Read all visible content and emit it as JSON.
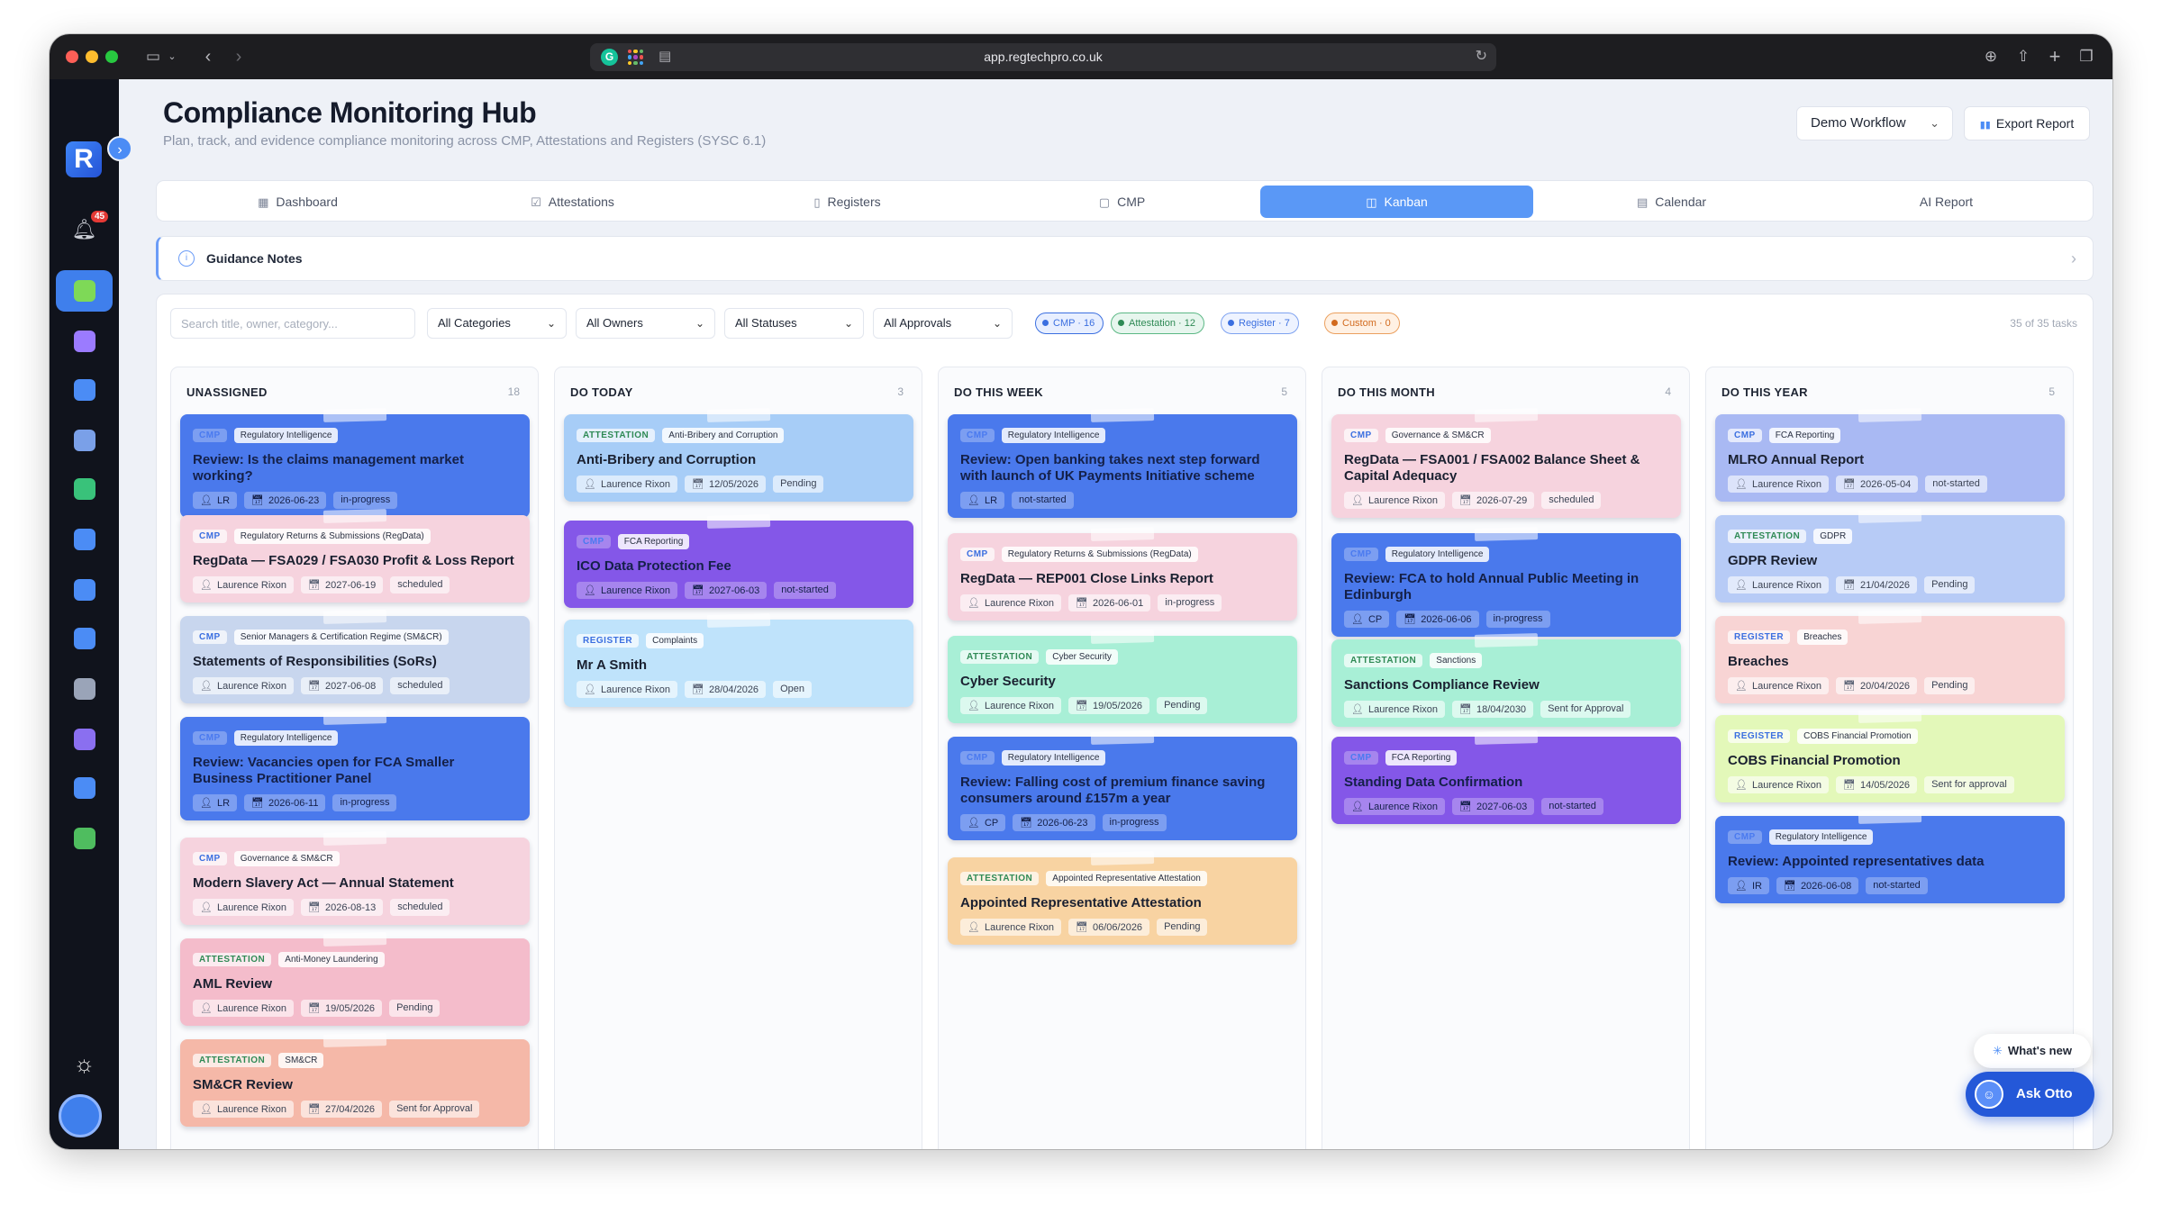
{
  "browser": {
    "url": "app.regtechpro.co.uk"
  },
  "sidebar": {
    "logo": "R",
    "notification_count": "45",
    "items": [
      {
        "name": "sidebar-item-compliance",
        "icon": "document-check-icon",
        "color": "#6bc04b",
        "active": true
      },
      {
        "name": "sidebar-item-people",
        "icon": "people-icon",
        "color": "#9b7bff"
      },
      {
        "name": "sidebar-item-security",
        "icon": "shield-icon",
        "color": "#4b8cf5"
      },
      {
        "name": "sidebar-item-news",
        "icon": "newspaper-icon",
        "color": "#7aa0e8"
      },
      {
        "name": "sidebar-item-protection",
        "icon": "shield-check-icon",
        "color": "#39c27a"
      },
      {
        "name": "sidebar-item-monitor",
        "icon": "target-icon",
        "color": "#4b8cf5"
      },
      {
        "name": "sidebar-item-lock",
        "icon": "lock-shield-icon",
        "color": "#4b8cf5"
      },
      {
        "name": "sidebar-item-network",
        "icon": "network-icon",
        "color": "#4b8cf5"
      },
      {
        "name": "sidebar-item-bank",
        "icon": "bank-icon",
        "color": "#9aa4b8"
      },
      {
        "name": "sidebar-item-list",
        "icon": "list-icon",
        "color": "#8a6ff0"
      },
      {
        "name": "sidebar-item-edit",
        "icon": "edit-doc-icon",
        "color": "#4b8cf5"
      },
      {
        "name": "sidebar-item-card",
        "icon": "card-icon",
        "color": "#4fbd5f"
      }
    ]
  },
  "header": {
    "title": "Compliance Monitoring Hub",
    "subtitle": "Plan, track, and evidence compliance monitoring across CMP, Attestations and Registers (SYSC 6.1)",
    "workflow_select": "Demo Workflow",
    "export_label": "Export Report"
  },
  "tabs": [
    {
      "label": "Dashboard",
      "icon": "dashboard-icon",
      "glyph": "▦"
    },
    {
      "label": "Attestations",
      "icon": "checkbox-icon",
      "glyph": "☑"
    },
    {
      "label": "Registers",
      "icon": "book-icon",
      "glyph": "▯"
    },
    {
      "label": "CMP",
      "icon": "file-icon",
      "glyph": "▢"
    },
    {
      "label": "Kanban",
      "icon": "kanban-icon",
      "glyph": "◫",
      "active": true
    },
    {
      "label": "Calendar",
      "icon": "calendar-icon",
      "glyph": "▤"
    },
    {
      "label": "AI Report",
      "icon": "",
      "glyph": ""
    }
  ],
  "guidance": {
    "label": "Guidance Notes"
  },
  "filters": {
    "search_placeholder": "Search title, owner, category...",
    "categories": "All Categories",
    "owners": "All Owners",
    "statuses": "All Statuses",
    "approvals": "All Approvals",
    "chips": [
      {
        "label": "CMP · 16",
        "color": "#3b6fe0",
        "bg": "#e8efff",
        "border": "#3b6fe0"
      },
      {
        "label": "Attestation · 12",
        "color": "#2f8a55",
        "bg": "#e7f6ee",
        "border": "#5cb885"
      },
      {
        "label": "Register · 7",
        "color": "#3b6fe0",
        "bg": "#eef3ff",
        "border": "#7ea2f0"
      },
      {
        "label": "Custom · 0",
        "color": "#d26a1e",
        "bg": "#fff1e4",
        "border": "#eba05e"
      }
    ],
    "task_count": "35 of 35 tasks"
  },
  "columns": [
    {
      "title": "UNASSIGNED",
      "count": "18",
      "cards": [
        {
          "type": "CMP",
          "category": "Regulatory Intelligence",
          "title": "Review: Is the claims management market working?",
          "owner": "LR",
          "date": "2026-06-23",
          "status": "in-progress",
          "bg": "#4a79ec",
          "dark": true
        },
        {
          "type": "CMP",
          "category": "Regulatory Returns & Submissions (RegData)",
          "title": "RegData — FSA029 / FSA030 Profit & Loss Report",
          "owner": "Laurence Rixon",
          "date": "2027-06-19",
          "status": "scheduled",
          "bg": "#f6d3de",
          "typeColor": "#3b6fe0"
        },
        {
          "type": "CMP",
          "category": "Senior Managers & Certification Regime (SM&CR)",
          "title": "Statements of Responsibilities (SoRs)",
          "owner": "Laurence Rixon",
          "date": "2027-06-08",
          "status": "scheduled",
          "bg": "#c8d6ee",
          "typeColor": "#3b6fe0"
        },
        {
          "type": "CMP",
          "category": "Regulatory Intelligence",
          "title": "Review: Vacancies open for FCA Smaller Business Practitioner Panel",
          "owner": "LR",
          "date": "2026-06-11",
          "status": "in-progress",
          "bg": "#4a79ec",
          "dark": true
        },
        {
          "type": "CMP",
          "category": "Governance & SM&CR",
          "title": "Modern Slavery Act — Annual Statement",
          "owner": "Laurence Rixon",
          "date": "2026-08-13",
          "status": "scheduled",
          "bg": "#f6d3de",
          "typeColor": "#3b6fe0"
        },
        {
          "type": "ATTESTATION",
          "category": "Anti-Money Laundering",
          "title": "AML Review",
          "owner": "Laurence Rixon",
          "date": "19/05/2026",
          "status": "Pending",
          "bg": "#f4bccb",
          "typeColor": "#2f8a55"
        },
        {
          "type": "ATTESTATION",
          "category": "SM&CR",
          "title": "SM&CR Review",
          "owner": "Laurence Rixon",
          "date": "27/04/2026",
          "status": "Sent for Approval",
          "bg": "#f5b8a8",
          "typeColor": "#2f8a55"
        }
      ]
    },
    {
      "title": "DO TODAY",
      "count": "3",
      "cards": [
        {
          "type": "ATTESTATION",
          "category": "Anti-Bribery and Corruption",
          "title": "Anti-Bribery and Corruption",
          "owner": "Laurence Rixon",
          "date": "12/05/2026",
          "status": "Pending",
          "bg": "#a7cdf7",
          "typeColor": "#2f8a55"
        },
        {
          "type": "CMP",
          "category": "FCA Reporting",
          "title": "ICO Data Protection Fee",
          "owner": "Laurence Rixon",
          "date": "2027-06-03",
          "status": "not-started",
          "bg": "#8457e8",
          "dark": true
        },
        {
          "type": "REGISTER",
          "category": "Complaints",
          "title": "Mr A Smith",
          "owner": "Laurence Rixon",
          "date": "28/04/2026",
          "status": "Open",
          "bg": "#bfe3fb",
          "typeColor": "#3b6fe0"
        }
      ]
    },
    {
      "title": "DO THIS WEEK",
      "count": "5",
      "cards": [
        {
          "type": "CMP",
          "category": "Regulatory Intelligence",
          "title": "Review: Open banking takes next step forward with launch of UK Payments Initiative scheme",
          "owner": "LR",
          "date": "",
          "status": "not-started",
          "bg": "#4a79ec",
          "dark": true
        },
        {
          "type": "CMP",
          "category": "Regulatory Returns & Submissions (RegData)",
          "title": "RegData — REP001 Close Links Report",
          "owner": "Laurence Rixon",
          "date": "2026-06-01",
          "status": "in-progress",
          "bg": "#f6d3de",
          "typeColor": "#3b6fe0"
        },
        {
          "type": "ATTESTATION",
          "category": "Cyber Security",
          "title": "Cyber Security",
          "owner": "Laurence Rixon",
          "date": "19/05/2026",
          "status": "Pending",
          "bg": "#a8efd6",
          "typeColor": "#2f8a55"
        },
        {
          "type": "CMP",
          "category": "Regulatory Intelligence",
          "title": "Review: Falling cost of premium finance saving consumers around £157m a year",
          "owner": "CP",
          "date": "2026-06-23",
          "status": "in-progress",
          "bg": "#4a79ec",
          "dark": true
        },
        {
          "type": "ATTESTATION",
          "category": "Appointed Representative Attestation",
          "title": "Appointed Representative Attestation",
          "owner": "Laurence Rixon",
          "date": "06/06/2026",
          "status": "Pending",
          "bg": "#f8d3a2",
          "typeColor": "#2f8a55"
        }
      ]
    },
    {
      "title": "DO THIS MONTH",
      "count": "4",
      "cards": [
        {
          "type": "CMP",
          "category": "Governance & SM&CR",
          "title": "RegData — FSA001 / FSA002 Balance Sheet & Capital Adequacy",
          "owner": "Laurence Rixon",
          "date": "2026-07-29",
          "status": "scheduled",
          "bg": "#f6d3de",
          "typeColor": "#3b6fe0"
        },
        {
          "type": "CMP",
          "category": "Regulatory Intelligence",
          "title": "Review: FCA to hold Annual Public Meeting in Edinburgh",
          "owner": "CP",
          "date": "2026-06-06",
          "status": "in-progress",
          "bg": "#4a79ec",
          "dark": true
        },
        {
          "type": "ATTESTATION",
          "category": "Sanctions",
          "title": "Sanctions Compliance Review",
          "owner": "Laurence Rixon",
          "date": "18/04/2030",
          "status": "Sent for Approval",
          "bg": "#a8efd6",
          "typeColor": "#2f8a55"
        },
        {
          "type": "CMP",
          "category": "FCA Reporting",
          "title": "Standing Data Confirmation",
          "owner": "Laurence Rixon",
          "date": "2027-06-03",
          "status": "not-started",
          "bg": "#8457e8",
          "dark": true
        }
      ]
    },
    {
      "title": "DO THIS YEAR",
      "count": "5",
      "cards": [
        {
          "type": "CMP",
          "category": "FCA Reporting",
          "title": "MLRO Annual Report",
          "owner": "Laurence Rixon",
          "date": "2026-05-04",
          "status": "not-started",
          "bg": "#a9b9f3",
          "typeColor": "#3b6fe0"
        },
        {
          "type": "ATTESTATION",
          "category": "GDPR",
          "title": "GDPR Review",
          "owner": "Laurence Rixon",
          "date": "21/04/2026",
          "status": "Pending",
          "bg": "#b7cbf6",
          "typeColor": "#2f8a55"
        },
        {
          "type": "REGISTER",
          "category": "Breaches",
          "title": "Breaches",
          "owner": "Laurence Rixon",
          "date": "20/04/2026",
          "status": "Pending",
          "bg": "#f8d4d4",
          "typeColor": "#3b6fe0"
        },
        {
          "type": "REGISTER",
          "category": "COBS Financial Promotion",
          "title": "COBS Financial Promotion",
          "owner": "Laurence Rixon",
          "date": "14/05/2026",
          "status": "Sent for approval",
          "bg": "#e3f8b9",
          "typeColor": "#3b6fe0"
        },
        {
          "type": "CMP",
          "category": "Regulatory Intelligence",
          "title": "Review: Appointed representatives data",
          "owner": "IR",
          "date": "2026-06-08",
          "status": "not-started",
          "bg": "#4a79ec",
          "dark": true
        }
      ]
    }
  ],
  "floating": {
    "whats_new": "What's new",
    "ask_otto": "Ask Otto"
  }
}
